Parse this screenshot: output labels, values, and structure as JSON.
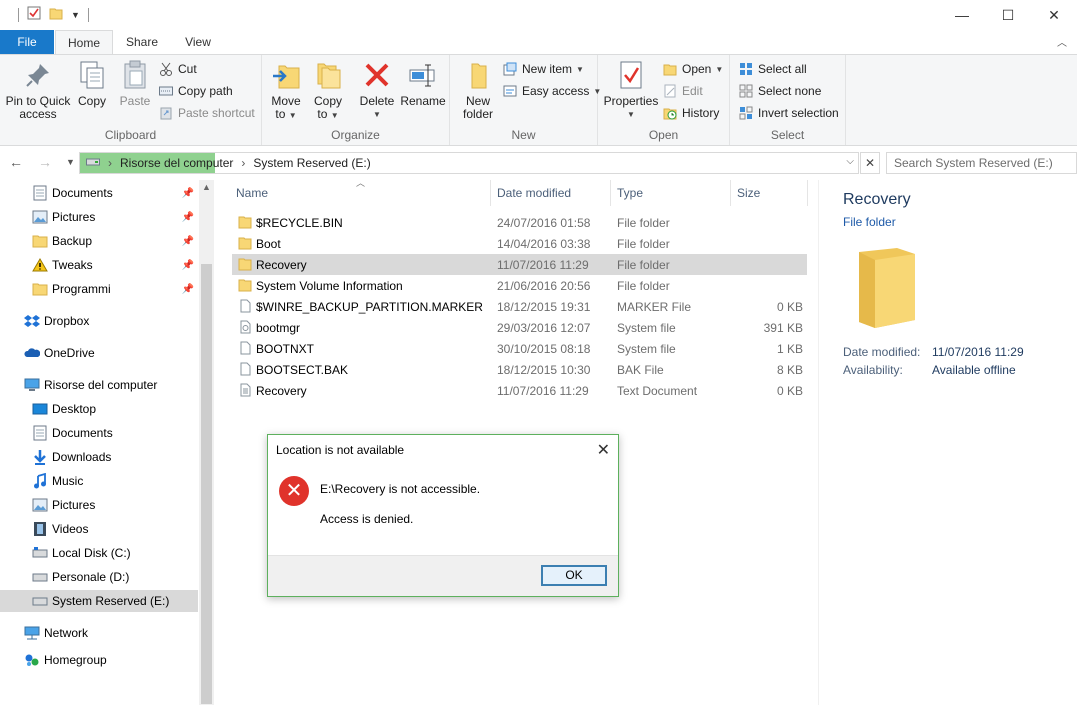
{
  "window": {
    "controls": {
      "minimize": "—",
      "maximize": "☐",
      "close": "✕"
    }
  },
  "tabs": [
    "File",
    "Home",
    "Share",
    "View"
  ],
  "ribbon": {
    "clipboard": {
      "label": "Clipboard",
      "pin": [
        "Pin to Quick",
        "access"
      ],
      "copy": "Copy",
      "paste": "Paste",
      "cut": "Cut",
      "copy_path": "Copy path",
      "paste_shortcut": "Paste shortcut"
    },
    "organize": {
      "label": "Organize",
      "move": [
        "Move",
        "to"
      ],
      "copy": [
        "Copy",
        "to"
      ],
      "delete": "Delete",
      "rename": "Rename"
    },
    "new": {
      "label": "New",
      "new_folder": [
        "New",
        "folder"
      ],
      "new_item": "New item",
      "easy_access": "Easy access"
    },
    "open": {
      "label": "Open",
      "properties": "Properties",
      "open": "Open",
      "edit": "Edit",
      "history": "History"
    },
    "select": {
      "label": "Select",
      "select_all": "Select all",
      "select_none": "Select none",
      "invert": "Invert selection"
    }
  },
  "address": {
    "segments": [
      "Risorse del computer",
      "System Reserved (E:)"
    ],
    "search_placeholder": "Search System Reserved (E:)"
  },
  "nav": {
    "quick": [
      {
        "label": "Documents",
        "icon": "documents-icon",
        "pinned": true
      },
      {
        "label": "Pictures",
        "icon": "pictures-icon",
        "pinned": true
      },
      {
        "label": "Backup",
        "icon": "folder-icon",
        "pinned": true
      },
      {
        "label": "Tweaks",
        "icon": "warning-icon",
        "pinned": true
      },
      {
        "label": "Programmi",
        "icon": "folder-icon",
        "pinned": true
      }
    ],
    "dropbox": "Dropbox",
    "onedrive": "OneDrive",
    "computer": "Risorse del computer",
    "computer_children": [
      {
        "label": "Desktop",
        "icon": "desktop-icon"
      },
      {
        "label": "Documents",
        "icon": "documents-icon"
      },
      {
        "label": "Downloads",
        "icon": "downloads-icon"
      },
      {
        "label": "Music",
        "icon": "music-icon"
      },
      {
        "label": "Pictures",
        "icon": "pictures-icon"
      },
      {
        "label": "Videos",
        "icon": "videos-icon"
      },
      {
        "label": "Local Disk (C:)",
        "icon": "drive-icon"
      },
      {
        "label": "Personale (D:)",
        "icon": "drive-icon"
      },
      {
        "label": "System Reserved (E:)",
        "icon": "drive-icon",
        "selected": true
      }
    ],
    "network": "Network",
    "homegroup": "Homegroup"
  },
  "columns": {
    "name": "Name",
    "date": "Date modified",
    "type": "Type",
    "size": "Size"
  },
  "files": [
    {
      "name": "$RECYCLE.BIN",
      "date": "24/07/2016 01:58",
      "type": "File folder",
      "size": "",
      "icon": "folder"
    },
    {
      "name": "Boot",
      "date": "14/04/2016 03:38",
      "type": "File folder",
      "size": "",
      "icon": "folder"
    },
    {
      "name": "Recovery",
      "date": "11/07/2016 11:29",
      "type": "File folder",
      "size": "",
      "icon": "folder",
      "selected": true
    },
    {
      "name": "System Volume Information",
      "date": "21/06/2016 20:56",
      "type": "File folder",
      "size": "",
      "icon": "folder"
    },
    {
      "name": "$WINRE_BACKUP_PARTITION.MARKER",
      "date": "18/12/2015 19:31",
      "type": "MARKER File",
      "size": "0 KB",
      "icon": "file"
    },
    {
      "name": "bootmgr",
      "date": "29/03/2016 12:07",
      "type": "System file",
      "size": "391 KB",
      "icon": "sysfile"
    },
    {
      "name": "BOOTNXT",
      "date": "30/10/2015 08:18",
      "type": "System file",
      "size": "1 KB",
      "icon": "file"
    },
    {
      "name": "BOOTSECT.BAK",
      "date": "18/12/2015 10:30",
      "type": "BAK File",
      "size": "8 KB",
      "icon": "file"
    },
    {
      "name": "Recovery",
      "date": "11/07/2016 11:29",
      "type": "Text Document",
      "size": "0 KB",
      "icon": "text"
    }
  ],
  "preview": {
    "title": "Recovery",
    "subtitle": "File folder",
    "date_label": "Date modified:",
    "date_value": "11/07/2016 11:29",
    "avail_label": "Availability:",
    "avail_value": "Available offline"
  },
  "dialog": {
    "title": "Location is not available",
    "message": "E:\\Recovery is not accessible.",
    "detail": "Access is denied.",
    "ok": "OK"
  },
  "colors": {
    "accent": "#1979ca",
    "selection": "#cce8ff",
    "error": "#e0332b",
    "address_progress": "#8fd18f"
  }
}
